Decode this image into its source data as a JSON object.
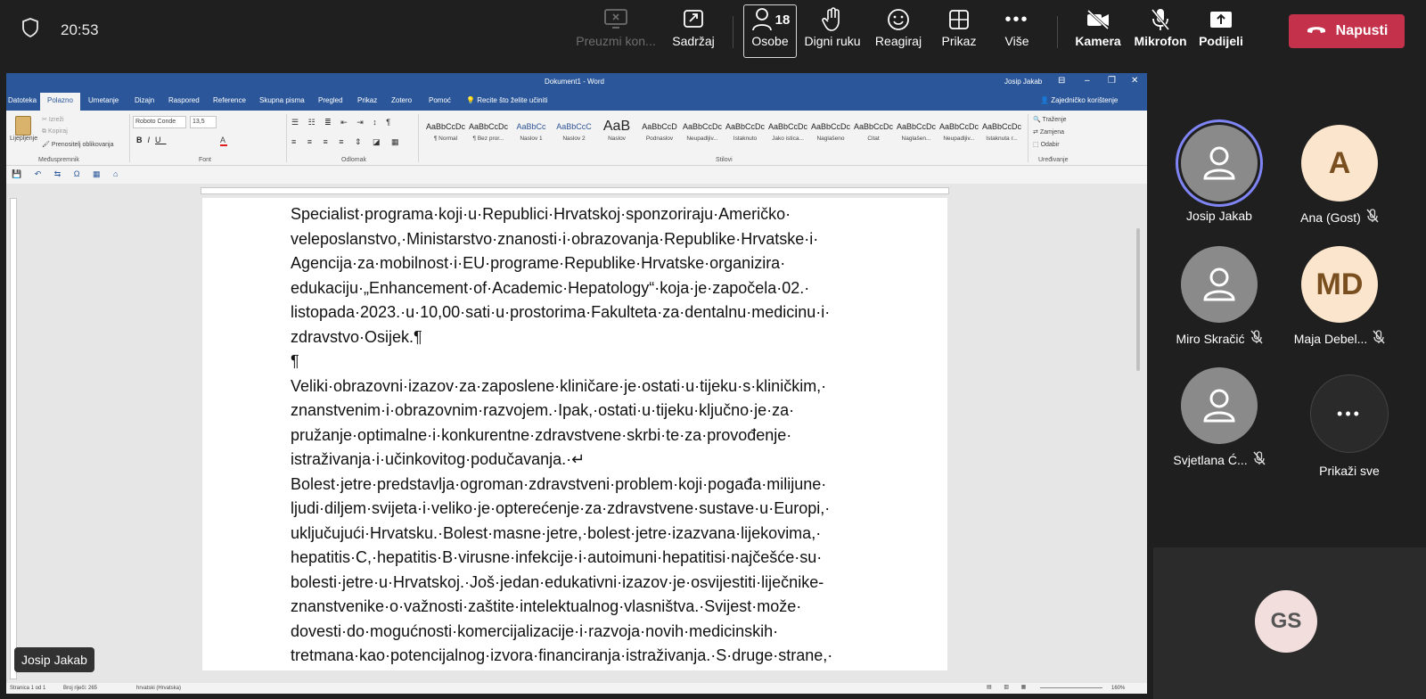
{
  "topbar": {
    "time": "20:53",
    "buttons": {
      "download": "Preuzmi kon...",
      "content": "Sadržaj",
      "people_count": "18",
      "people": "Osobe",
      "raise_hand": "Digni ruku",
      "react": "Reagiraj",
      "view": "Prikaz",
      "more": "Više",
      "camera": "Kamera",
      "mic": "Mikrofon",
      "share": "Podijeli",
      "leave": "Napusti"
    },
    "leave_color": "#c4314b"
  },
  "word": {
    "title": "Dokument1 - Word",
    "user": "Josip Jakab",
    "tabs": [
      "Datoteka",
      "Polazno",
      "Umetanje",
      "Dizajn",
      "Raspored",
      "Reference",
      "Skupna pisma",
      "Pregled",
      "Prikaz",
      "Zotero",
      "Pomoć",
      "Recite što želite učiniti"
    ],
    "share_label": "Zajedničko korištenje",
    "ribbon": {
      "clipboard": {
        "paste": "Lijepljenje",
        "cut": "Izreži",
        "copy": "Kopiraj",
        "format_painter": "Prenositelj oblikovanja",
        "label": "Međuspremnik"
      },
      "font": {
        "name": "Roboto Conde",
        "size": "13,5",
        "label": "Font"
      },
      "paragraph": {
        "label": "Odlomak"
      },
      "styles": {
        "label": "Stilovi",
        "items": [
          {
            "sample": "AaBbCcDc",
            "name": "¶ Normal"
          },
          {
            "sample": "AaBbCcDc",
            "name": "¶ Bez pror..."
          },
          {
            "sample": "AaBbCc",
            "name": "Naslov 1"
          },
          {
            "sample": "AaBbCcC",
            "name": "Naslov 2"
          },
          {
            "sample": "AaB",
            "name": "Naslov"
          },
          {
            "sample": "AaBbCcD",
            "name": "Podnaslov"
          },
          {
            "sample": "AaBbCcDc",
            "name": "Neupadljiv..."
          },
          {
            "sample": "AaBbCcDc",
            "name": "Istaknuto"
          },
          {
            "sample": "AaBbCcDc",
            "name": "Jako istica..."
          },
          {
            "sample": "AaBbCcDc",
            "name": "Naglašeno"
          },
          {
            "sample": "AaBbCcDc",
            "name": "Citat"
          },
          {
            "sample": "AaBbCcDc",
            "name": "Naglašen..."
          },
          {
            "sample": "AaBbCcDc",
            "name": "Neupadljiv..."
          },
          {
            "sample": "AaBbCcDc",
            "name": "Istaknuta r..."
          }
        ]
      },
      "editing": {
        "find": "Traženje",
        "replace": "Zamjena",
        "select": "Odabir",
        "label": "Uređivanje"
      }
    },
    "document": {
      "paragraphs": [
        "Specialist·programa·koji·u·Republici·Hrvatskoj·sponzoriraju·Američko· veleposlanstvo,·Ministarstvo·znanosti·i·obrazovanja·Republike·Hrvatske·i· Agencija·za·mobilnost·i·EU·programe·Republike·Hrvatske·organizira· edukaciju·„Enhancement·of·Academic·Hepatology“·koja·je·započela·02.· listopada·2023.·u·10,00·sati·u·prostorima·Fakulteta·za·dentalnu·medicinu·i· zdravstvo·Osijek.¶",
        "¶",
        "Veliki·obrazovni·izazov·za·zaposlene·kliničare·je·ostati·u·tijeku·s·kliničkim,· znanstvenim·i·obrazovnim·razvojem.·Ipak,·ostati·u·tijeku·ključno·je·za· pružanje·optimalne·i·konkurentne·zdravstvene·skrbi·te·za·provođenje· istraživanja·i·učinkovitog·podučavanja.·↵",
        "Bolest·jetre·predstavlja·ogroman·zdravstveni·problem·koji·pogađa·milijune· ljudi·diljem·svijeta·i·veliko·je·opterećenje·za·zdravstvene·sustave·u·Europi,· uključujući·Hrvatsku.·Bolest·masne·jetre,·bolest·jetre·izazvana·lijekovima,· hepatitis·C,·hepatitis·B·virusne·infekcije·i·autoimuni·hepatitisi·najčešće·su· bolesti·jetre·u·Hrvatskoj.·Još·jedan·edukativni·izazov·je·osvijestiti·liječnike- znanstvenike·o·važnosti·zaštite·intelektualnog·vlasništva.·Svijest·može· dovesti·do·mogućnosti·komercijalizacije·i·razvoja·novih·medicinskih· tretmana·kao·potencijalnog·izvora·financiranja·istraživanja.·S·druge·strane,·"
      ]
    },
    "status": {
      "page": "Stranica 1 od 1",
      "words": "Broj riječi: 265",
      "language": "hrvatski (Hrvatska)",
      "zoom": "160%"
    }
  },
  "presenter_tag": "Josip Jakab",
  "participants": [
    {
      "name": "Josip Jakab",
      "initials": "",
      "muted": false,
      "speaking": true
    },
    {
      "name": "Ana (Gost)",
      "initials": "A",
      "muted": true,
      "speaking": false
    },
    {
      "name": "Miro Skračić",
      "initials": "",
      "muted": true,
      "speaking": false
    },
    {
      "name": "Maja Debel...",
      "initials": "MD",
      "muted": true,
      "speaking": false
    },
    {
      "name": "Svjetlana Ć...",
      "initials": "",
      "muted": true,
      "speaking": false
    }
  ],
  "show_all": "Prikaži sve",
  "self_initials": "GS"
}
